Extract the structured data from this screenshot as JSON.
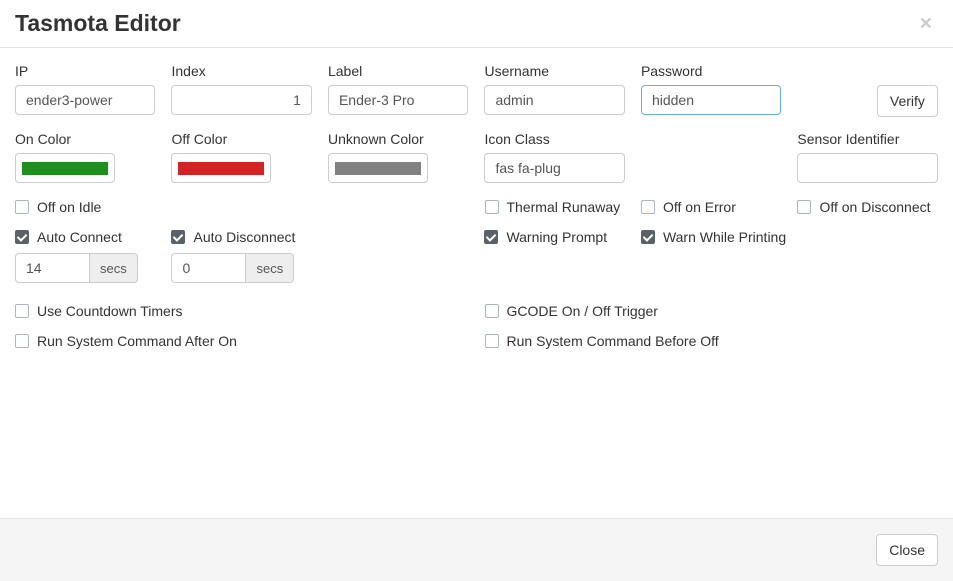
{
  "header": {
    "title": "Tasmota Editor",
    "close_x": "×"
  },
  "row1": {
    "ip": {
      "label": "IP",
      "value": "ender3-power"
    },
    "index": {
      "label": "Index",
      "value": "1"
    },
    "label": {
      "label": "Label",
      "value": "Ender-3 Pro"
    },
    "username": {
      "label": "Username",
      "value": "admin"
    },
    "password": {
      "label": "Password",
      "value": "hidden"
    },
    "verify": {
      "label": "Verify"
    }
  },
  "row2": {
    "on_color": {
      "label": "On Color",
      "color": "#1e8f1e"
    },
    "off_color": {
      "label": "Off Color",
      "color": "#d22424"
    },
    "unknown_color": {
      "label": "Unknown Color",
      "color": "#808080"
    },
    "icon_class": {
      "label": "Icon Class",
      "value": "fas fa-plug"
    },
    "sensor_id": {
      "label": "Sensor Identifier",
      "value": ""
    }
  },
  "row3": {
    "off_on_idle": {
      "label": "Off on Idle",
      "checked": false
    },
    "thermal_runaway": {
      "label": "Thermal Runaway",
      "checked": false
    },
    "off_on_error": {
      "label": "Off on Error",
      "checked": false
    },
    "off_on_disconnect": {
      "label": "Off on Disconnect",
      "checked": false
    }
  },
  "row4": {
    "auto_connect": {
      "label": "Auto Connect",
      "checked": true,
      "value": "14",
      "unit": "secs"
    },
    "auto_disconnect": {
      "label": "Auto Disconnect",
      "checked": true,
      "value": "0",
      "unit": "secs"
    },
    "warning_prompt": {
      "label": "Warning Prompt",
      "checked": true
    },
    "warn_while_printing": {
      "label": "Warn While Printing",
      "checked": true
    }
  },
  "row5": {
    "use_countdown": {
      "label": "Use Countdown Timers",
      "checked": false
    },
    "gcode_trigger": {
      "label": "GCODE On / Off Trigger",
      "checked": false
    }
  },
  "row6": {
    "cmd_after_on": {
      "label": "Run System Command After On",
      "checked": false
    },
    "cmd_before_off": {
      "label": "Run System Command Before Off",
      "checked": false
    }
  },
  "footer": {
    "close": "Close"
  }
}
